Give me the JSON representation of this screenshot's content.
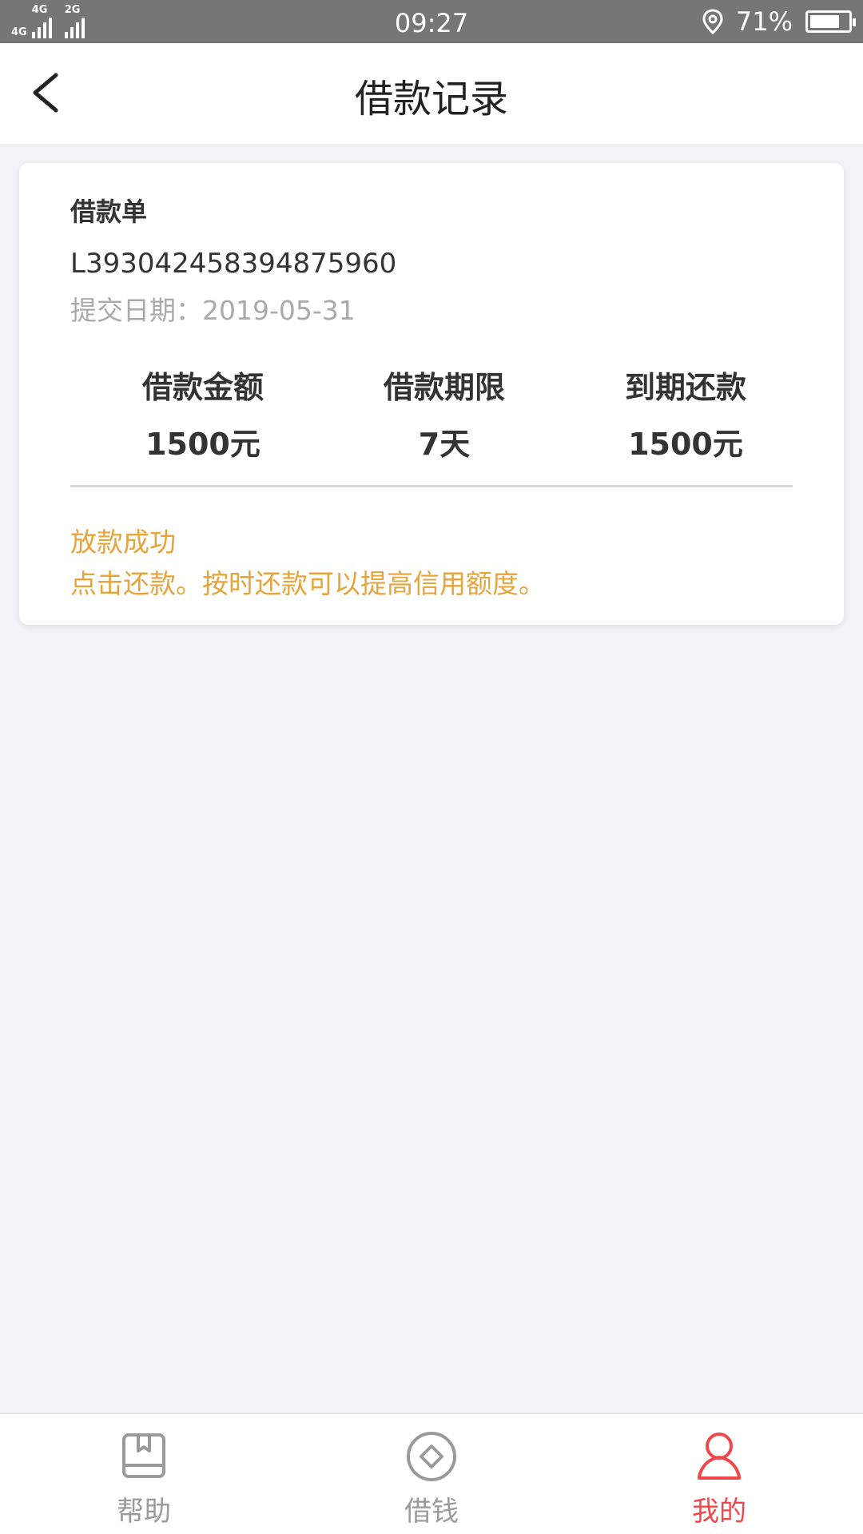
{
  "status_bar": {
    "network1": "4G",
    "network2": "4G",
    "network3": "2G",
    "time": "09:27",
    "battery": "71%",
    "battery_level": 0.71
  },
  "navbar": {
    "title": "借款记录"
  },
  "loan_card": {
    "title": "借款单",
    "order_number": "L393042458394875960",
    "submit_date": "提交日期：2019-05-31",
    "stats": [
      {
        "label": "借款金额",
        "value": "1500元"
      },
      {
        "label": "借款期限",
        "value": "7天"
      },
      {
        "label": "到期还款",
        "value": "1500元"
      }
    ],
    "status": "放款成功",
    "message": "点击还款。按时还款可以提高信用额度。",
    "accent_color": "#e6a43a"
  },
  "tabbar": {
    "items": [
      {
        "label": "帮助",
        "icon": "book-icon"
      },
      {
        "label": "借钱",
        "icon": "diamond-coin-icon"
      },
      {
        "label": "我的",
        "icon": "user-icon",
        "active": true
      }
    ],
    "active_color": "#f0484a"
  }
}
